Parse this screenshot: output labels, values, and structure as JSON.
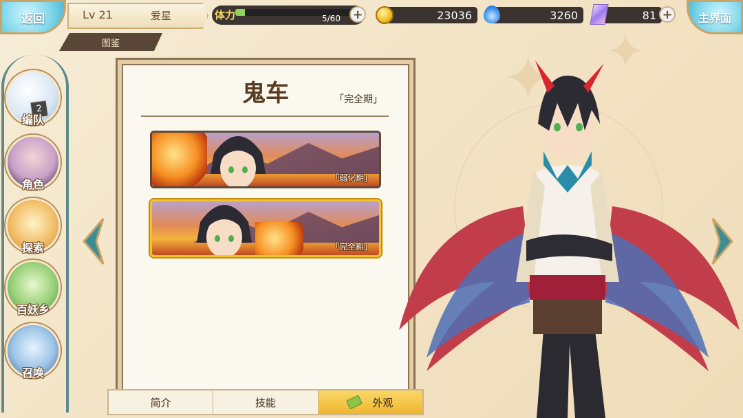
{
  "top_bar": {
    "back_label": "返回",
    "level": "Lv 21",
    "player_name": "爱星",
    "subtab": "图鉴",
    "stamina_label": "体力",
    "stamina_value": "5/60",
    "stamina_fraction": 0.083,
    "coins": "23036",
    "soul_jade": "3260",
    "crystals": "81",
    "main_label": "主界面"
  },
  "nav": {
    "items": [
      {
        "label": "编队",
        "badge": "2"
      },
      {
        "label": "角色"
      },
      {
        "label": "探索"
      },
      {
        "label": "百妖乡"
      },
      {
        "label": "召唤"
      }
    ]
  },
  "panel": {
    "title": "鬼车",
    "stage": "「完全期」",
    "skins": [
      {
        "label": "「弱化期」",
        "selected": false
      },
      {
        "label": "「完全期」",
        "selected": true
      }
    ]
  },
  "tabs": {
    "intro": "简介",
    "skills": "技能",
    "appearance": "外观"
  },
  "colors": {
    "accent_gold": "#f2c32c",
    "panel_border": "#8c7257",
    "teal": "#7fd6ea"
  }
}
